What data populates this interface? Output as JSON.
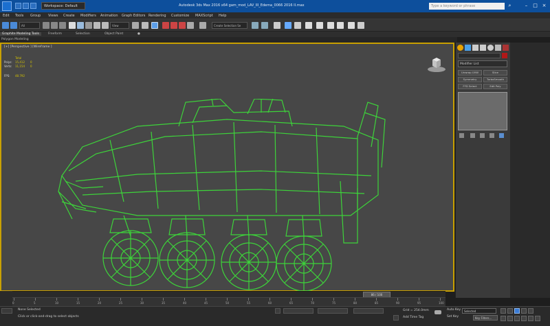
{
  "titlebar": {
    "workspace": "Workspace: Default",
    "title": "Autodesk 3ds Max 2016 x64 gam_mod_LAV_III_Edema_0066 2016 II.max",
    "search_placeholder": "Type a keyword or phrase"
  },
  "menu": [
    "Edit",
    "Tools",
    "Group",
    "Views",
    "Create",
    "Modifiers",
    "Animation",
    "Graph Editors",
    "Rendering",
    "Customize",
    "MAXScript",
    "Help"
  ],
  "toolbar": {
    "selection_filter": "All",
    "reference_coord": "View",
    "named_selection": "Create Selection Se"
  },
  "ribbon": {
    "tabs": [
      "Graphite Modeling Tools",
      "Freeform",
      "Selection",
      "Object Paint"
    ],
    "sub_label": "Polygon Modeling"
  },
  "viewport": {
    "label": "[+] [Perspective ] [Wireframe ]",
    "stats": {
      "total_label": "Total",
      "polys_label": "Polys:",
      "polys_value": "15,412",
      "polys_sel": "0",
      "verts_label": "Verts:",
      "verts_value": "11,154",
      "verts_sel": "0",
      "fps_label": "FPS:",
      "fps_value": "48.792"
    }
  },
  "command_panel": {
    "modifier_list": "Modifier List",
    "buttons": [
      "Unwrap UVW",
      "Slice",
      "Symmetry",
      "TurboSmooth",
      "FFD Select",
      "Edit Poly"
    ]
  },
  "timeline": {
    "frame_display": "86 / 100",
    "ticks": [
      "0",
      "5",
      "10",
      "15",
      "20",
      "25",
      "30",
      "35",
      "40",
      "45",
      "50",
      "55",
      "60",
      "65",
      "70",
      "75",
      "80",
      "85",
      "90",
      "95",
      "100"
    ]
  },
  "status": {
    "selection": "None Selected",
    "prompt": "Click or click-and-drag to select objects",
    "grid": "Grid = 254.0mm",
    "add_time_tag": "Add Time Tag",
    "auto_key": "Auto Key",
    "set_key": "Set Key",
    "selected_option": "Selected",
    "key_filters": "Key Filters..."
  },
  "colors": {
    "titlebar": "#0d4f9c",
    "viewport_bg": "#474747",
    "viewport_border": "#c9a000",
    "wireframe": "#3dd43a",
    "stat_value": "#d6c400"
  }
}
